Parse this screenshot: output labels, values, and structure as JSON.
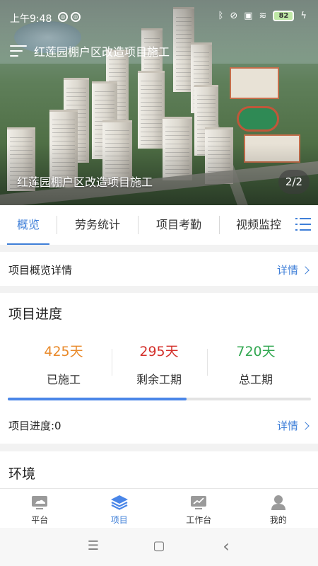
{
  "status_bar": {
    "time": "上午9:48",
    "battery": "82"
  },
  "hero": {
    "top_title": "红莲园棚户区改造项目施工",
    "caption": "红莲园棚户区改造项目施工",
    "pager": "2/2"
  },
  "tabs": [
    {
      "label": "概览",
      "active": true
    },
    {
      "label": "劳务统计",
      "active": false
    },
    {
      "label": "项目考勤",
      "active": false
    },
    {
      "label": "视频监控",
      "active": false
    }
  ],
  "overview": {
    "title": "项目概览详情",
    "detail_label": "详情"
  },
  "progress": {
    "title": "项目进度",
    "stats": [
      {
        "value": "425天",
        "label": "已施工",
        "color": "#e98a2b"
      },
      {
        "value": "295天",
        "label": "剩余工期",
        "color": "#d4302b"
      },
      {
        "value": "720天",
        "label": "总工期",
        "color": "#33a852"
      }
    ],
    "bar_fraction": 0.59,
    "footer_label": "项目进度:0",
    "detail_label": "详情"
  },
  "environment": {
    "title": "环境"
  },
  "bottom_nav": [
    {
      "label": "平台",
      "icon": "platform-icon",
      "active": false
    },
    {
      "label": "项目",
      "icon": "layers-icon",
      "active": true
    },
    {
      "label": "工作台",
      "icon": "workbench-icon",
      "active": false
    },
    {
      "label": "我的",
      "icon": "person-icon",
      "active": false
    }
  ],
  "system_nav": {
    "menu": "☰",
    "home": "▢",
    "back": "‹"
  },
  "colors": {
    "accent": "#3f7fd8"
  }
}
